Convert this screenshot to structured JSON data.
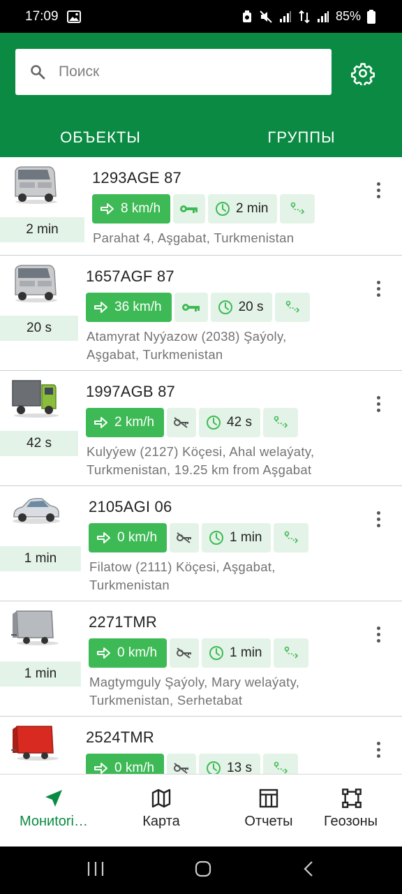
{
  "status_bar": {
    "time": "17:09",
    "battery": "85%"
  },
  "search": {
    "placeholder": "Поиск",
    "value": ""
  },
  "tabs": [
    {
      "label": "ОБЪЕКТЫ"
    },
    {
      "label": "ГРУППЫ"
    }
  ],
  "units": [
    {
      "name": "1293AGE 87",
      "last_update": "2 min",
      "speed": "8 km/h",
      "ignition": "on",
      "chip_time": "2 min",
      "address_lines": [
        "Parahat 4, Aşgabat, Turkmenistan"
      ],
      "vehicle": "minibus"
    },
    {
      "name": "1657AGF 87",
      "last_update": "20 s",
      "speed": "36 km/h",
      "ignition": "on",
      "chip_time": "20 s",
      "address_lines": [
        "Atamyrat Nyýazow (2038) Şaýoly,",
        "Aşgabat, Turkmenistan"
      ],
      "vehicle": "minibus"
    },
    {
      "name": "1997AGB 87",
      "last_update": "42 s",
      "speed": "2 km/h",
      "ignition": "off",
      "chip_time": "42 s",
      "address_lines": [
        "Kulyýew (2127) Köçesi, Ahal welaýaty,",
        "Turkmenistan, 19.25 km from Aşgabat"
      ],
      "vehicle": "truck"
    },
    {
      "name": "2105AGI 06",
      "last_update": "1 min",
      "speed": "0 km/h",
      "ignition": "off",
      "chip_time": "1 min",
      "address_lines": [
        "Filatow (2111) Köçesi, Aşgabat,",
        "Turkmenistan"
      ],
      "vehicle": "car"
    },
    {
      "name": "2271TMR",
      "last_update": "1 min",
      "speed": "0 km/h",
      "ignition": "off",
      "chip_time": "1 min",
      "address_lines": [
        "Magtymguly Şaýoly, Mary welaýaty,",
        "Turkmenistan, Serhetabat"
      ],
      "vehicle": "trailer-gray"
    },
    {
      "name": "2524TMR",
      "last_update": "",
      "speed": "0 km/h",
      "ignition": "off",
      "chip_time": "13 s",
      "address_lines": [],
      "vehicle": "trailer-red"
    }
  ],
  "bottom_nav": [
    {
      "label": "Мониtori…",
      "active": true
    },
    {
      "label": "Карта",
      "active": false
    },
    {
      "label": "Отчеты",
      "active": false
    },
    {
      "label": "Геозоны",
      "active": false
    }
  ],
  "colors": {
    "primary": "#0b8a43",
    "speed_chip": "#3dba55",
    "chip_bg": "#e4f3e7"
  }
}
